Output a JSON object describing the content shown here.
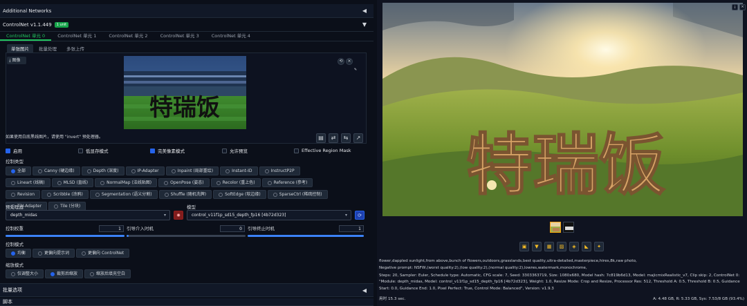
{
  "left": {
    "additional_networks": "Additional Networks",
    "controlnet_title": "ControlNet v1.1.449",
    "controlnet_badge": "1 unit",
    "tabs": [
      "ControlNet 单元 0",
      "ControlNet 单元 1",
      "ControlNet 单元 2",
      "ControlNet 单元 3",
      "ControlNet 单元 4"
    ],
    "subtabs": [
      "单张图片",
      "批量处理",
      "多张上传"
    ],
    "image_btn": "⤓ 图像",
    "canvas_text": "特瑞饭",
    "canvas_hint": "如果使用白底黑线图片，请使用 \"invert\" 预处理器。",
    "checkboxes": {
      "enable": "启用",
      "lowvram": "低显存模式",
      "pixel_perfect": "完美像素模式",
      "allow_preview": "允许预览",
      "effective_region": "Effective Region Mask"
    },
    "control_type_label": "控制类型",
    "control_types": [
      "全部",
      "Canny (硬边缘)",
      "Depth (深度)",
      "IP-Adapter",
      "Inpaint (局部重绘)",
      "Instant-ID",
      "InstructP2P",
      "Lineart (线稿)",
      "MLSD (直线)",
      "NormalMap (法线贴图)",
      "OpenPose (姿态)",
      "Recolor (重上色)",
      "Reference (参考)",
      "Revision",
      "Scribble (涂鸦)",
      "Segmentation (语义分割)",
      "Shuffle (随机洗牌)",
      "SoftEdge (软边缘)",
      "SparseCtrl (稀疏控制)",
      "T2I-Adapter",
      "Tile (分块)"
    ],
    "preprocessor_label": "预处理器",
    "preprocessor_value": "depth_midas",
    "model_label": "模型",
    "model_value": "control_v11f1p_sd15_depth_fp16 [4b72d323]",
    "weight_label": "控制权重",
    "weight_value": "1",
    "start_label": "引导介入时机",
    "start_value": "0",
    "end_label": "引导终止时机",
    "end_value": "1",
    "control_mode_label": "控制模式",
    "control_modes": [
      "均衡",
      "更偏向提示词",
      "更偏向 ControlNet"
    ],
    "resize_label": "缩放模式",
    "resize_modes": [
      "仅调整大小",
      "裁剪后缩放",
      "缩放后填充空白"
    ],
    "batch_options": "批量选项",
    "bottom_partial": "脚本"
  },
  "right": {
    "image_text": "特瑞饭",
    "positive": "flower,dappled sunlight,from above,bunch of flowers,outdoors,grasslands,best quality,ultra-detailed,masterpiece,hires,8k,raw photo,",
    "negative": "Negative prompt: NSFW,(worst quality:2),(low quality:2),(normal quality:2),lowres,watermark,monochrome,",
    "params": "Steps: 20, Sampler: Euler, Schedule type: Automatic, CFG scale: 7, Seed: 3303363719, Size: 1080x680, Model hash: 7c819b6d13, Model: majicmixRealistic_v7, Clip skip: 2, ControlNet 0: \"Module: depth_midas, Model: control_v11f1p_sd15_depth_fp16 [4b72d323], Weight: 1.0, Resize Mode: Crop and Resize, Processor Res: 512, Threshold A: 0.5, Threshold B: 0.5, Guidance Start: 0.0, Guidance End: 1.0, Pixel Perfect: True, Control Mode: Balanced\", Version: v1.9.3",
    "time_label": "用时 15.3 sec.",
    "vram_label": "A: 4.48 GB, R: 5.33 GB, Sys: 7.53/8 GB (93.4%)",
    "tools": [
      "folder-icon",
      "save-icon",
      "zip-icon",
      "img2img-icon",
      "inpaint-icon",
      "extras-icon",
      "sparkle-icon"
    ]
  },
  "colors": {
    "accent": "#22c55e",
    "primary": "#2563eb",
    "bg": "#0b0f19"
  }
}
